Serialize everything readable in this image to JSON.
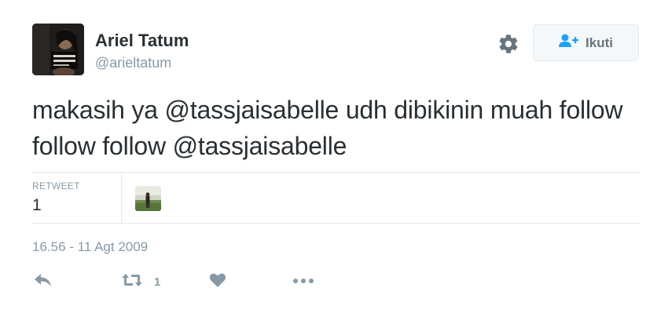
{
  "user": {
    "name": "Ariel Tatum",
    "handle": "@arieltatum"
  },
  "follow_button": {
    "label": "Ikuti",
    "icon": "follow-user-icon"
  },
  "settings_icon": "gear-icon",
  "tweet": {
    "text": "makasih ya @tassjaisabelle udh dibikinin muah follow follow follow @tassjaisabelle"
  },
  "stats": {
    "retweet_label": "RETWEET",
    "retweet_count": "1"
  },
  "timestamp": "16.56 - 11 Agt 2009",
  "actions": {
    "reply_icon": "reply-icon",
    "retweet_icon": "retweet-icon",
    "retweet_count": "1",
    "like_icon": "heart-icon",
    "more_icon": "more-dots-icon"
  },
  "colors": {
    "text": "#292f33",
    "secondary": "#8899a6",
    "icon": "#657786",
    "follow_icon": "#1da1f2",
    "border": "#e1e8ed"
  }
}
